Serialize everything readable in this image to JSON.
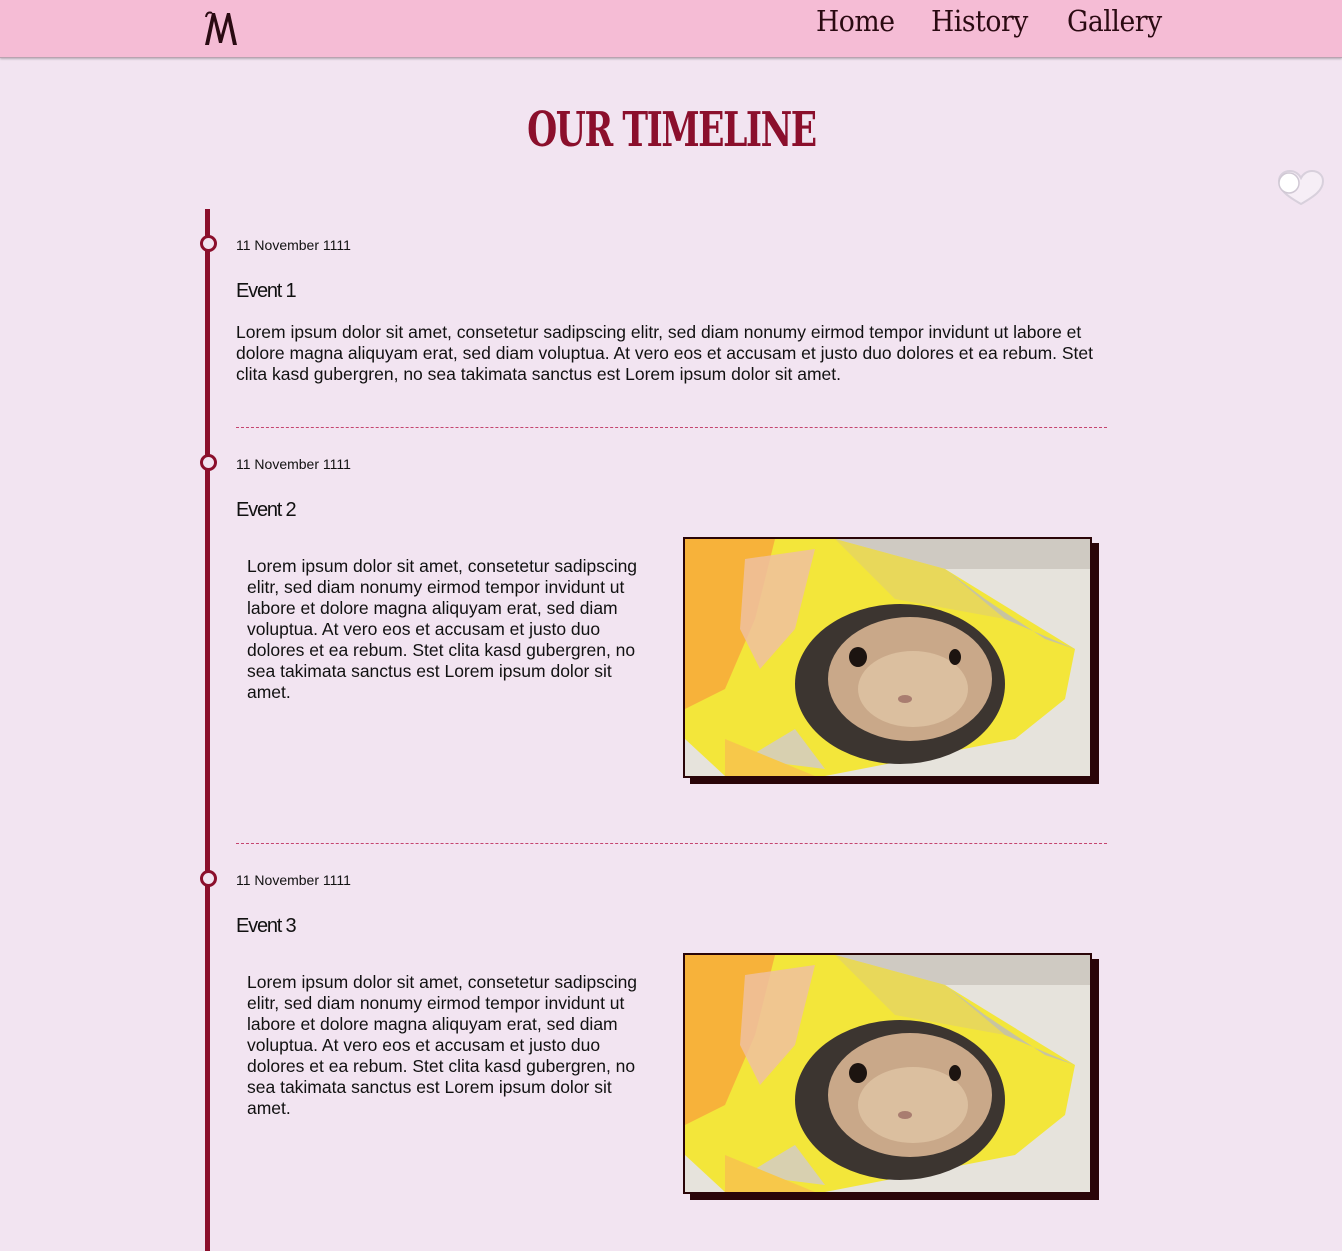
{
  "nav": {
    "logo_icon": "m-monogram-logo",
    "links": [
      "Home",
      "History",
      "Gallery"
    ]
  },
  "page": {
    "title": "OUR TIMELINE",
    "toggle_icon": "heart-toggle-icon"
  },
  "colors": {
    "navbar": "#f5bcd5",
    "background": "#f2e4f1",
    "accent": "#8b0f2c",
    "divider": "#c5446f"
  },
  "events": [
    {
      "date": "11 November 1111",
      "title": "Event 1",
      "description": "Lorem ipsum dolor sit amet, consetetur sadipscing elitr, sed diam nonumy eirmod tempor invidunt ut labore et dolore magna aliquyam erat, sed diam voluptua. At vero eos et accusam et justo duo dolores et ea rebum. Stet clita kasd gubergren, no sea takimata sanctus est Lorem ipsum dolor sit amet."
    },
    {
      "date": "11 November 1111",
      "title": "Event 2",
      "description": "Lorem ipsum dolor sit amet, consetetur sadipscing elitr, sed diam nonumy eirmod tempor invidunt ut labore et dolore magna aliquyam erat, sed diam voluptua. At vero eos et accusam et justo duo dolores et ea rebum. Stet clita kasd gubergren, no sea takimata sanctus est Lorem ipsum dolor sit amet.",
      "image": "bunny-in-chip-bag-photo"
    },
    {
      "date": "11 November 1111",
      "title": "Event 3",
      "description": "Lorem ipsum dolor sit amet, consetetur sadipscing elitr, sed diam nonumy eirmod tempor invidunt ut labore et dolore magna aliquyam erat, sed diam voluptua. At vero eos et accusam et justo duo dolores et ea rebum. Stet clita kasd gubergren, no sea takimata sanctus est Lorem ipsum dolor sit amet.",
      "image": "bunny-in-chip-bag-photo"
    }
  ]
}
